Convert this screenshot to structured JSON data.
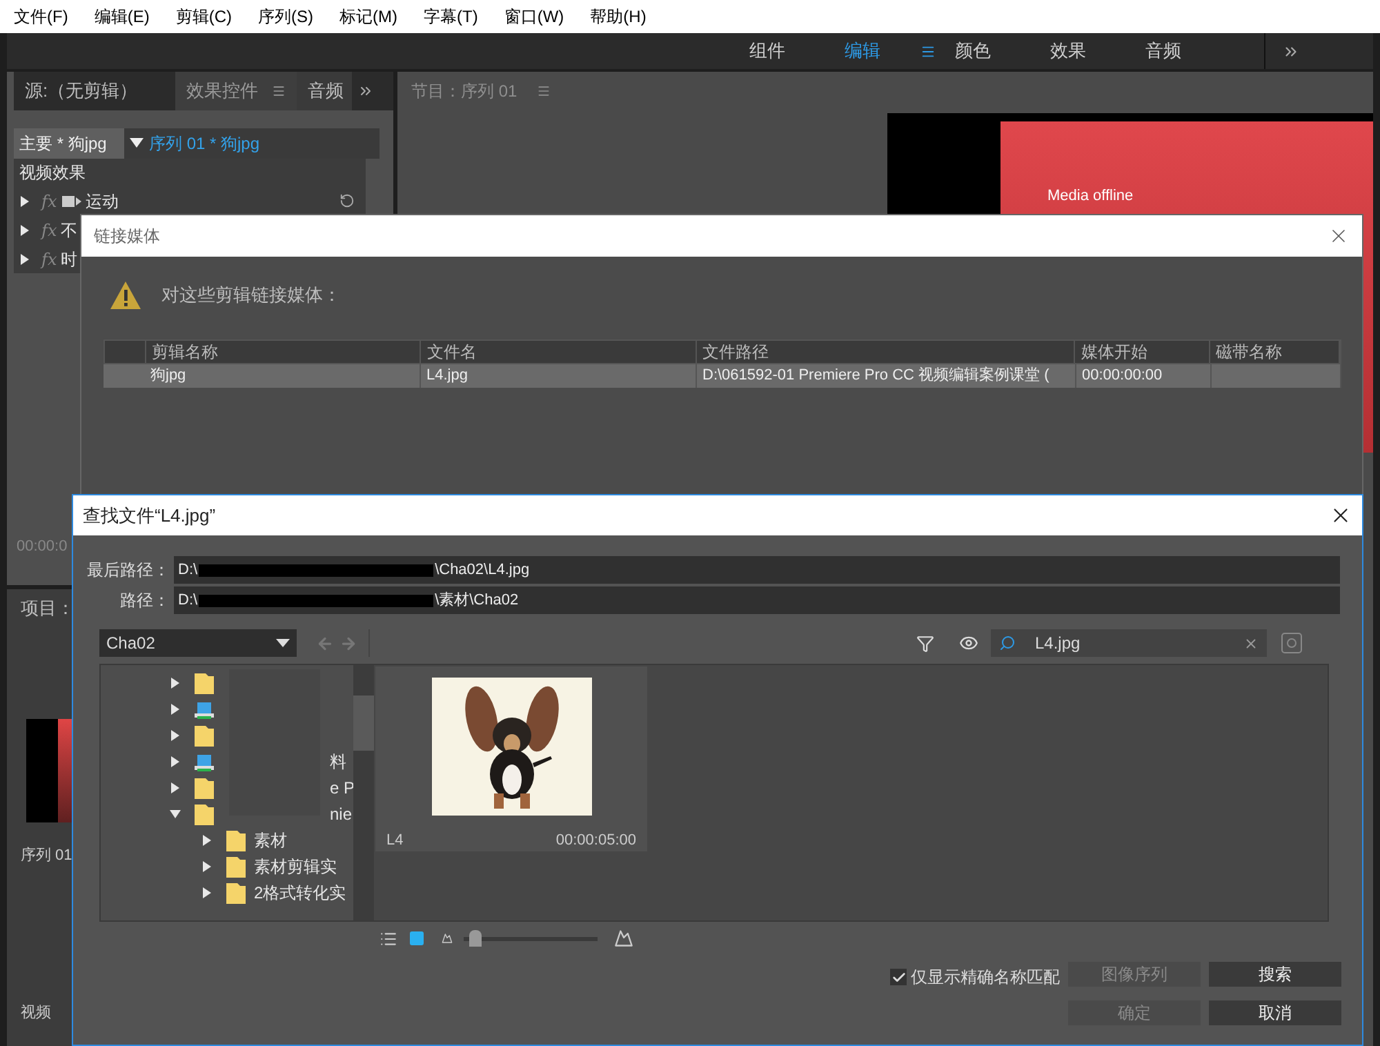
{
  "menu": [
    "文件(F)",
    "编辑(E)",
    "剪辑(C)",
    "序列(S)",
    "标记(M)",
    "字幕(T)",
    "窗口(W)",
    "帮助(H)"
  ],
  "workspaces": [
    {
      "label": "组件",
      "selected": false
    },
    {
      "label": "编辑",
      "selected": true
    },
    {
      "label": "颜色",
      "selected": false
    },
    {
      "label": "效果",
      "selected": false
    },
    {
      "label": "音频",
      "selected": false
    }
  ],
  "source_panel": {
    "tabs": [
      {
        "label": "源:（无剪辑）",
        "selected": false
      },
      {
        "label": "效果控件",
        "selected": true
      },
      {
        "label": "音频",
        "selected": false
      }
    ],
    "master": "主要 * 狗jpg",
    "sequence": "序列 01 * 狗jpg",
    "section": "视频效果",
    "effects": [
      {
        "fx": "fx",
        "name": "运动"
      },
      {
        "fx": "fx",
        "name": "不"
      },
      {
        "fx": "fx",
        "name": "时"
      }
    ],
    "timecode": "00:00:0"
  },
  "program_panel": {
    "title": "节目：序列 01",
    "offline": "Media offline"
  },
  "project_panel": {
    "title": "项目：",
    "sequence": "序列 01",
    "track": "视频"
  },
  "link_dialog": {
    "title": "链接媒体",
    "message": "对这些剪辑链接媒体：",
    "columns": [
      "剪辑名称",
      "文件名",
      "文件路径",
      "媒体开始",
      "磁带名称"
    ],
    "rows": [
      {
        "selected": true,
        "cells": [
          "狗jpg",
          "L4.jpg",
          "D:\\061592-01 Premiere Pro CC 视频编辑案例课堂 (",
          "00:00:00:00",
          ""
        ]
      }
    ]
  },
  "find_dialog": {
    "title": "查找文件“L4.jpg”",
    "paths": [
      {
        "label": "最后路径：",
        "start": "D:\\",
        "end": "\\Cha02\\L4.jpg"
      },
      {
        "label": "路径：",
        "start": "D:\\",
        "end": "\\素材\\Cha02"
      }
    ],
    "location": "Cha02",
    "search": "L4.jpg",
    "tree": [
      {
        "kind": "folder",
        "expanded": false
      },
      {
        "kind": "drive",
        "expanded": false
      },
      {
        "kind": "folder",
        "expanded": false
      },
      {
        "kind": "drive",
        "expanded": false,
        "label": "料"
      },
      {
        "kind": "folder",
        "expanded": false,
        "label": "e P"
      },
      {
        "kind": "folder",
        "expanded": true,
        "label": "nie",
        "children": [
          {
            "kind": "folder",
            "expanded": false,
            "label": "素材"
          },
          {
            "kind": "folder",
            "expanded": false,
            "label": "素材剪辑实"
          },
          {
            "kind": "folder",
            "expanded": false,
            "label": "2格式转化实"
          }
        ]
      }
    ],
    "files": [
      {
        "kind": "picture",
        "name": "L4",
        "duration": "00:00:05:00"
      }
    ],
    "zoom": {
      "level": 0.05
    },
    "exact_match": {
      "label": "仅显示精确名称匹配",
      "checked": true
    },
    "buttons": [
      {
        "label": "图像序列",
        "disabled": true
      },
      {
        "label": "搜索",
        "disabled": false
      },
      {
        "label": "确定",
        "disabled": true
      },
      {
        "label": "取消",
        "disabled": false
      }
    ]
  }
}
